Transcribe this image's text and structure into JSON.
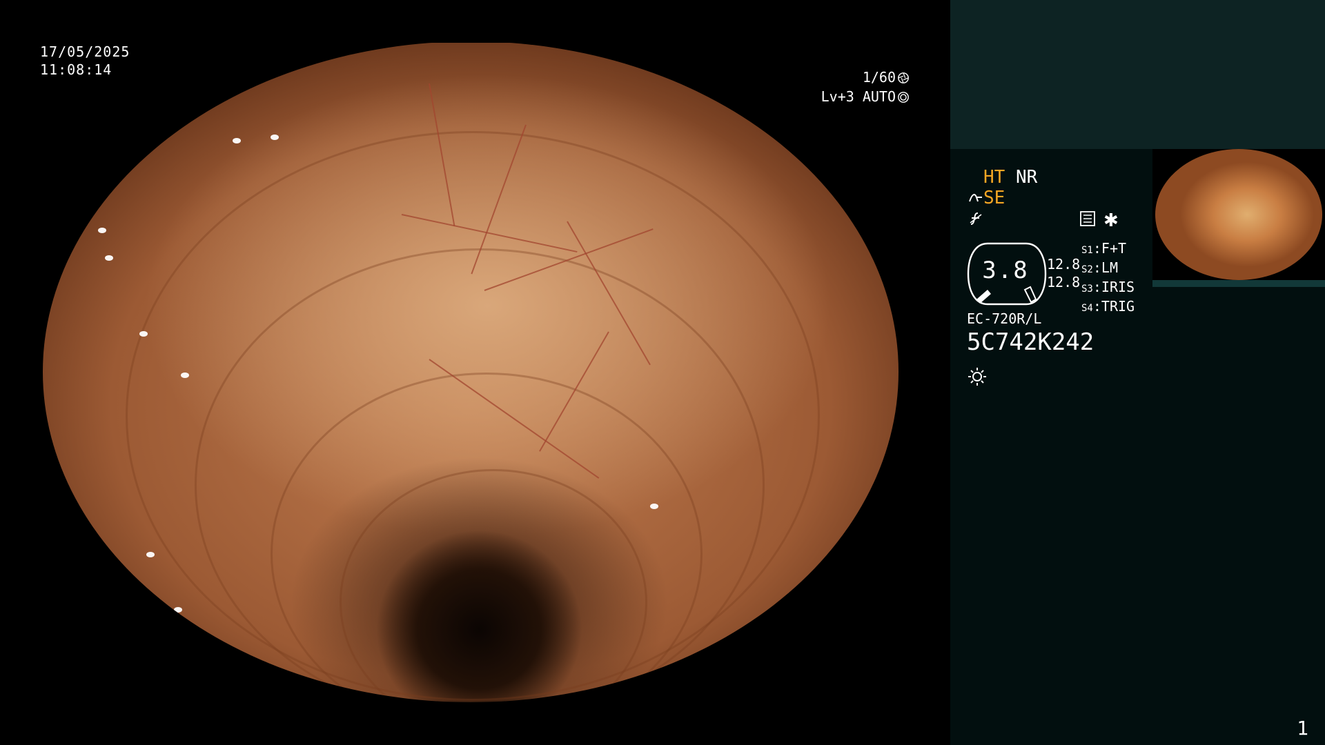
{
  "overlay": {
    "date": "17/05/2025",
    "time": "11:08:14",
    "shutter": "1/60",
    "level": "Lv+3 AUTO"
  },
  "panel": {
    "ht": "HT",
    "nr": "NR",
    "se": "SE",
    "zoom_value": "3.8",
    "num_top": "12.8",
    "num_bottom": "12.8",
    "switches": [
      {
        "key": "S1",
        "value": "F+T"
      },
      {
        "key": "S2",
        "value": "LM"
      },
      {
        "key": "S3",
        "value": "IRIS"
      },
      {
        "key": "S4",
        "value": "TRIG"
      }
    ],
    "scope_model": "EC-720R/L",
    "serial": "5C742K242",
    "page": "1"
  },
  "icons": {
    "shutter": "aperture-icon",
    "auto": "target-icon",
    "se": "scope-curve-icon",
    "f": "f-slash-icon",
    "menu": "list-box-icon",
    "star": "asterisk-icon",
    "light": "sun-icon"
  },
  "colors": {
    "accent_orange": "#f5a623",
    "panel_bg": "#020f0f",
    "panel_top": "#0d2323"
  }
}
